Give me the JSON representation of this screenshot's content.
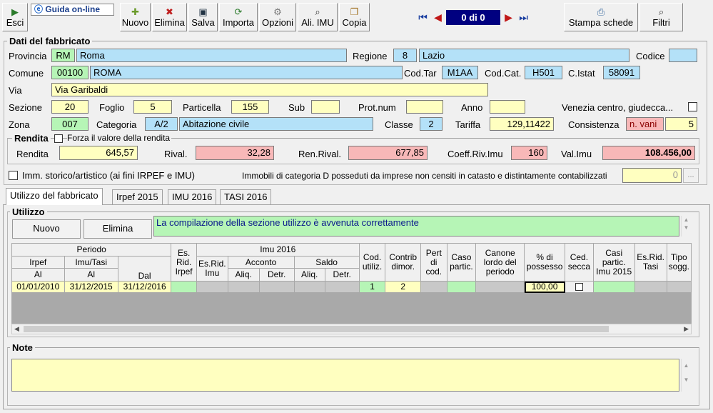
{
  "toolbar": {
    "esci": "Esci",
    "guida": "Guida on-line",
    "nuovo": "Nuovo",
    "elimina": "Elimina",
    "salva": "Salva",
    "importa": "Importa",
    "opzioni": "Opzioni",
    "ali_imu": "Ali. IMU",
    "copia": "Copia",
    "stampa": "Stampa schede",
    "filtri": "Filtri"
  },
  "nav": {
    "record": "0 di 0"
  },
  "fabbricato": {
    "title": "Dati del fabbricato",
    "provincia_label": "Provincia",
    "provincia_code": "RM",
    "provincia_name": "Roma",
    "regione_label": "Regione",
    "regione_code": "8",
    "regione_name": "Lazio",
    "codice_label": "Codice",
    "codice": "",
    "comune_label": "Comune",
    "comune_code": "00100",
    "comune_name": "ROMA",
    "codtar_label": "Cod.Tar",
    "codtar": "M1AA",
    "codcat_label": "Cod.Cat.",
    "codcat": "H501",
    "cistat_label": "C.Istat",
    "cistat": "58091",
    "via_label": "Via",
    "via": "Via Garibaldi",
    "sezione_label": "Sezione",
    "sezione": "20",
    "foglio_label": "Foglio",
    "foglio": "5",
    "particella_label": "Particella",
    "particella": "155",
    "sub_label": "Sub",
    "sub": "",
    "protnum_label": "Prot.num",
    "protnum": "",
    "anno_label": "Anno",
    "anno": "",
    "venezia_label": "Venezia centro, giudecca...",
    "zona_label": "Zona",
    "zona": "007",
    "categoria_label": "Categoria",
    "categoria_code": "A/2",
    "categoria_name": "Abitazione civile",
    "classe_label": "Classe",
    "classe": "2",
    "tariffa_label": "Tariffa",
    "tariffa": "129,11422",
    "consistenza_label": "Consistenza",
    "consistenza_unit": "n. vani",
    "consistenza": "5"
  },
  "rendita": {
    "title": "Rendita",
    "forza_label": "Forza il valore della rendita",
    "rendita_label": "Rendita",
    "rendita": "645,57",
    "rival_label": "Rival.",
    "rival": "32,28",
    "renrival_label": "Ren.Rival.",
    "renrival": "677,85",
    "coeff_label": "Coeff.Riv.Imu",
    "coeff": "160",
    "valimu_label": "Val.Imu",
    "valimu": "108.456,00"
  },
  "storico_label": "Imm. storico/artistico (ai fini IRPEF e IMU)",
  "catd_label": "Immobili di categoria D posseduti da imprese non censiti in catasto e distintamente contabilizzati",
  "catd_value": "0",
  "ellipsis": "...",
  "tabs": [
    "Utilizzo del fabbricato",
    "Irpef 2015",
    "IMU 2016",
    "TASI 2016"
  ],
  "utilizzo": {
    "title": "Utilizzo",
    "nuovo": "Nuovo",
    "elimina": "Elimina",
    "message": "La compilazione della sezione utilizzo è avvenuta correttamente"
  },
  "grid": {
    "h_periodo": "Periodo",
    "h_irpef": "Irpef",
    "h_imutasi": "Imu/Tasi",
    "h_dal": "Dal",
    "h_al1": "Al",
    "h_al2": "Al",
    "h_esrid": "Es. Rid. Irpef",
    "h_imu2016": "Imu 2016",
    "h_esridimu": "Es.Rid. Imu",
    "h_acconto": "Acconto",
    "h_saldo": "Saldo",
    "h_aliq1": "Aliq.",
    "h_detr1": "Detr.",
    "h_aliq2": "Aliq.",
    "h_detr2": "Detr.",
    "h_codutil": "Cod. utiliz.",
    "h_contrib": "Contrib dimor.",
    "h_pert": "Pert di cod.",
    "h_caso": "Caso partic.",
    "h_canone": "Canone lordo del periodo",
    "h_possesso": "% di possesso",
    "h_cedsecca": "Ced. secca",
    "h_casi": "Casi partic. Imu 2015",
    "h_esridtasi": "Es.Rid. Tasi",
    "h_tipo": "Tipo sogg.",
    "row": {
      "dal": "01/01/2010",
      "al1": "31/12/2015",
      "al2": "31/12/2016",
      "codutil": "1",
      "contrib": "2",
      "possesso": "100,00"
    }
  },
  "note": {
    "title": "Note",
    "text": ""
  },
  "colors": {
    "yellow": "#ffffc0",
    "blue": "#b4e1f8",
    "green": "#b6f5b6",
    "pink": "#f8b8b8",
    "navy": "#000080"
  },
  "icons": [
    "exit-icon",
    "help-icon",
    "new-icon",
    "delete-icon",
    "save-icon",
    "import-icon",
    "options-icon",
    "ali-imu-icon",
    "copy-icon",
    "print-icon",
    "filter-icon"
  ]
}
